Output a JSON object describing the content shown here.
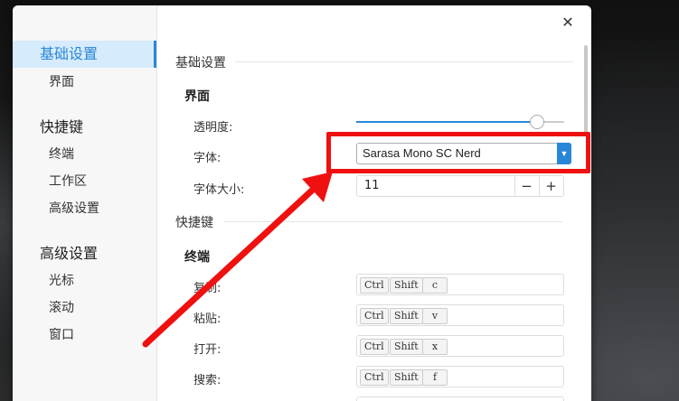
{
  "sidebar": {
    "items": [
      {
        "label": "基础设置",
        "type": "group",
        "active": true
      },
      {
        "label": "界面",
        "type": "sub"
      },
      {
        "label": "快捷键",
        "type": "group"
      },
      {
        "label": "终端",
        "type": "sub"
      },
      {
        "label": "工作区",
        "type": "sub"
      },
      {
        "label": "高级设置",
        "type": "sub"
      },
      {
        "label": "高级设置",
        "type": "group"
      },
      {
        "label": "光标",
        "type": "sub"
      },
      {
        "label": "滚动",
        "type": "sub"
      },
      {
        "label": "窗口",
        "type": "sub"
      }
    ]
  },
  "dialog": {
    "close_icon": "✕"
  },
  "content": {
    "basic_title": "基础设置",
    "interface_title": "界面",
    "opacity_label": "透明度:",
    "opacity_value": 0.87,
    "font_label": "字体:",
    "font_value": "Sarasa Mono SC Nerd",
    "font_size_label": "字体大小:",
    "font_size_value": "11",
    "minus": "−",
    "plus": "+",
    "shortcuts_title": "快捷键",
    "terminal_title": "终端",
    "shortcuts": [
      {
        "label": "复制:",
        "keys": [
          "Ctrl",
          "Shift",
          "c"
        ]
      },
      {
        "label": "粘贴:",
        "keys": [
          "Ctrl",
          "Shift",
          "v"
        ]
      },
      {
        "label": "打开:",
        "keys": [
          "Ctrl",
          "Shift",
          "x"
        ]
      },
      {
        "label": "搜索:",
        "keys": [
          "Ctrl",
          "Shift",
          "f"
        ]
      }
    ]
  },
  "annotation": {
    "color": "#ef1010"
  },
  "colors": {
    "accent": "#2a86d8"
  }
}
